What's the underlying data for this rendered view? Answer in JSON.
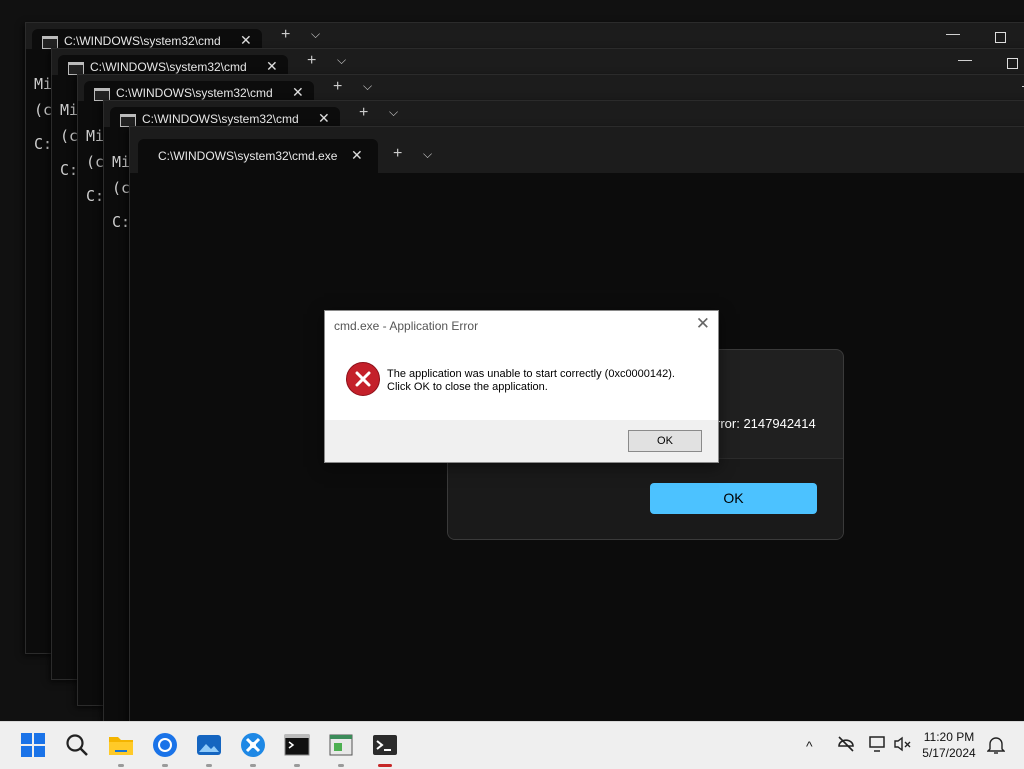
{
  "terminals": [
    {
      "tab_title": "C:\\WINDOWS\\system32\\cmd",
      "line1": "Mi",
      "line2": "(c",
      "line3": "C:"
    },
    {
      "tab_title": "C:\\WINDOWS\\system32\\cmd",
      "line1": "Mi",
      "line2": "(c",
      "line3": "C:"
    },
    {
      "tab_title": "C:\\WINDOWS\\system32\\cmd",
      "line1": "Mi",
      "line2": "(c",
      "line3": "C:"
    },
    {
      "tab_title": "C:\\WINDOWS\\system32\\cmd",
      "line1": "Mi",
      "line2": "(c",
      "line3": "C:"
    },
    {
      "tab_title": "C:\\WINDOWS\\system32\\cmd.exe"
    }
  ],
  "tab_close_glyph": "✕",
  "tab_new_glyph": "+",
  "tab_dropdown_glyph": "⌵",
  "win_min_glyph": "—",
  "w11_dialog": {
    "error_text": "rror: 2147942414",
    "ok_label": "OK"
  },
  "error_dialog": {
    "title": "cmd.exe - Application Error",
    "message_line1": "The application was unable to start correctly (0xc0000142).",
    "message_line2": "Click OK to close the application.",
    "ok_label": "OK",
    "close_glyph": "✕"
  },
  "taskbar": {
    "clock_time": "11:20 PM",
    "clock_date": "5/17/2024",
    "tray_chevron": "^"
  },
  "colors": {
    "accent": "#4cc2ff",
    "error_red": "#c4202a"
  }
}
